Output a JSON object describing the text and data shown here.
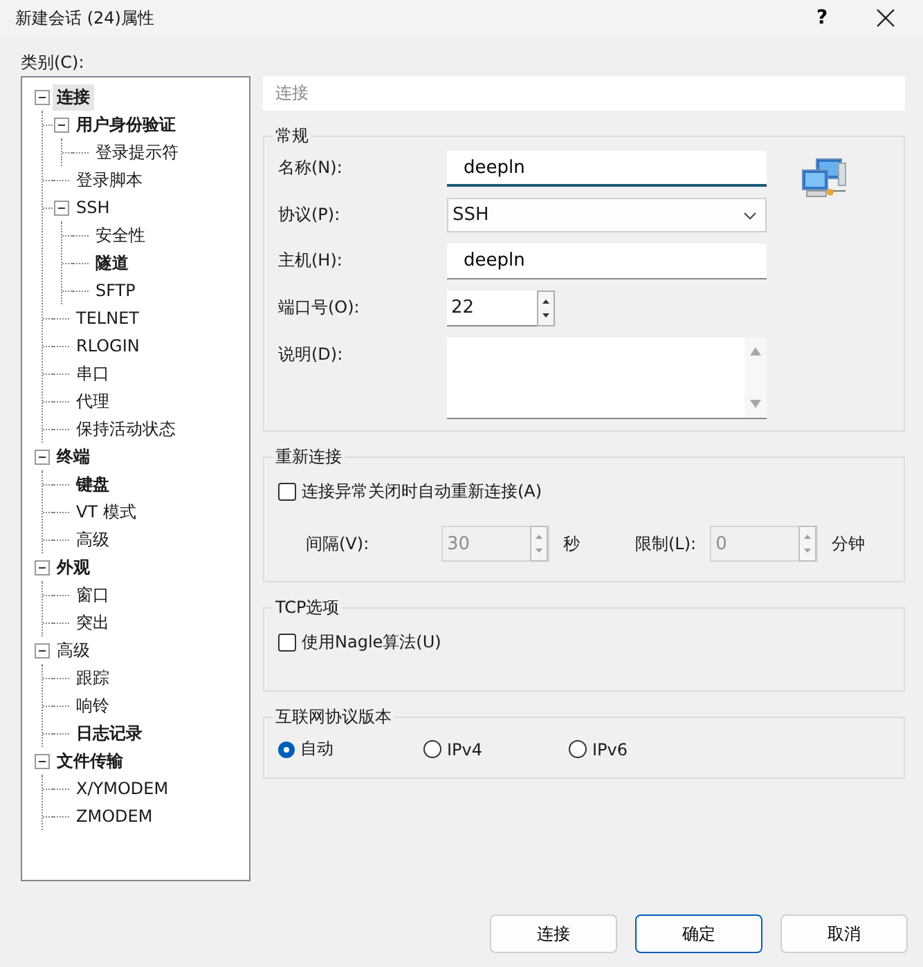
{
  "window": {
    "title": "新建会话 (24)属性",
    "help": "?"
  },
  "category_label": "类别(C):",
  "tree": [
    {
      "label": "连接",
      "bold": true,
      "selected": true,
      "expanded": true,
      "children": [
        {
          "label": "用户身份验证",
          "bold": true,
          "selected": false,
          "expanded": true,
          "children": [
            {
              "label": "登录提示符",
              "bold": false,
              "selected": false
            }
          ]
        },
        {
          "label": "登录脚本",
          "bold": false,
          "selected": false
        },
        {
          "label": "SSH",
          "bold": false,
          "selected": false,
          "expanded": true,
          "children": [
            {
              "label": "安全性",
              "bold": false,
              "selected": false
            },
            {
              "label": "隧道",
              "bold": true,
              "selected": false
            },
            {
              "label": "SFTP",
              "bold": false,
              "selected": false
            }
          ]
        },
        {
          "label": "TELNET",
          "bold": false,
          "selected": false
        },
        {
          "label": "RLOGIN",
          "bold": false,
          "selected": false
        },
        {
          "label": "串口",
          "bold": false,
          "selected": false
        },
        {
          "label": "代理",
          "bold": false,
          "selected": false
        },
        {
          "label": "保持活动状态",
          "bold": false,
          "selected": false
        }
      ]
    },
    {
      "label": "终端",
      "bold": true,
      "selected": false,
      "expanded": true,
      "children": [
        {
          "label": "键盘",
          "bold": true,
          "selected": false
        },
        {
          "label": "VT 模式",
          "bold": false,
          "selected": false
        },
        {
          "label": "高级",
          "bold": false,
          "selected": false
        }
      ]
    },
    {
      "label": "外观",
      "bold": true,
      "selected": false,
      "expanded": true,
      "children": [
        {
          "label": "窗口",
          "bold": false,
          "selected": false
        },
        {
          "label": "突出",
          "bold": false,
          "selected": false
        }
      ]
    },
    {
      "label": "高级",
      "bold": false,
      "selected": false,
      "expanded": true,
      "children": [
        {
          "label": "跟踪",
          "bold": false,
          "selected": false
        },
        {
          "label": "响铃",
          "bold": false,
          "selected": false
        },
        {
          "label": "日志记录",
          "bold": true,
          "selected": false
        }
      ]
    },
    {
      "label": "文件传输",
      "bold": true,
      "selected": false,
      "expanded": true,
      "children": [
        {
          "label": "X/YMODEM",
          "bold": false,
          "selected": false
        },
        {
          "label": "ZMODEM",
          "bold": false,
          "selected": false
        }
      ]
    }
  ],
  "page_header": "连接",
  "general": {
    "title": "常规",
    "fields": [
      {
        "kind": "text",
        "label": "名称(N):",
        "value": "deepln",
        "focused": true
      },
      {
        "kind": "select",
        "label": "协议(P):",
        "value": "SSH"
      },
      {
        "kind": "text",
        "label": "主机(H):",
        "value": "deepln",
        "focused": false
      },
      {
        "kind": "spin",
        "label": "端口号(O):",
        "value": "22"
      },
      {
        "kind": "textarea",
        "label": "说明(D):"
      }
    ]
  },
  "reconnect": {
    "title": "重新连接",
    "checkbox": {
      "label": "连接异常关闭时自动重新连接(A)",
      "checked": false
    },
    "spins": [
      {
        "label": "间隔(V):",
        "value": "30",
        "unit": "秒",
        "disabled": true
      },
      {
        "label": "限制(L):",
        "value": "0",
        "unit": "分钟",
        "disabled": true
      }
    ]
  },
  "tcp": {
    "title": "TCP选项",
    "checkbox": {
      "label": "使用Nagle算法(U)",
      "checked": false
    }
  },
  "ip": {
    "title": "互联网协议版本",
    "options": [
      {
        "label": "自动",
        "selected": true
      },
      {
        "label": "IPv4",
        "selected": false
      },
      {
        "label": "IPv6",
        "selected": false
      }
    ]
  },
  "buttons": [
    {
      "label": "连接",
      "default": false
    },
    {
      "label": "确定",
      "default": true
    },
    {
      "label": "取消",
      "default": false
    }
  ]
}
